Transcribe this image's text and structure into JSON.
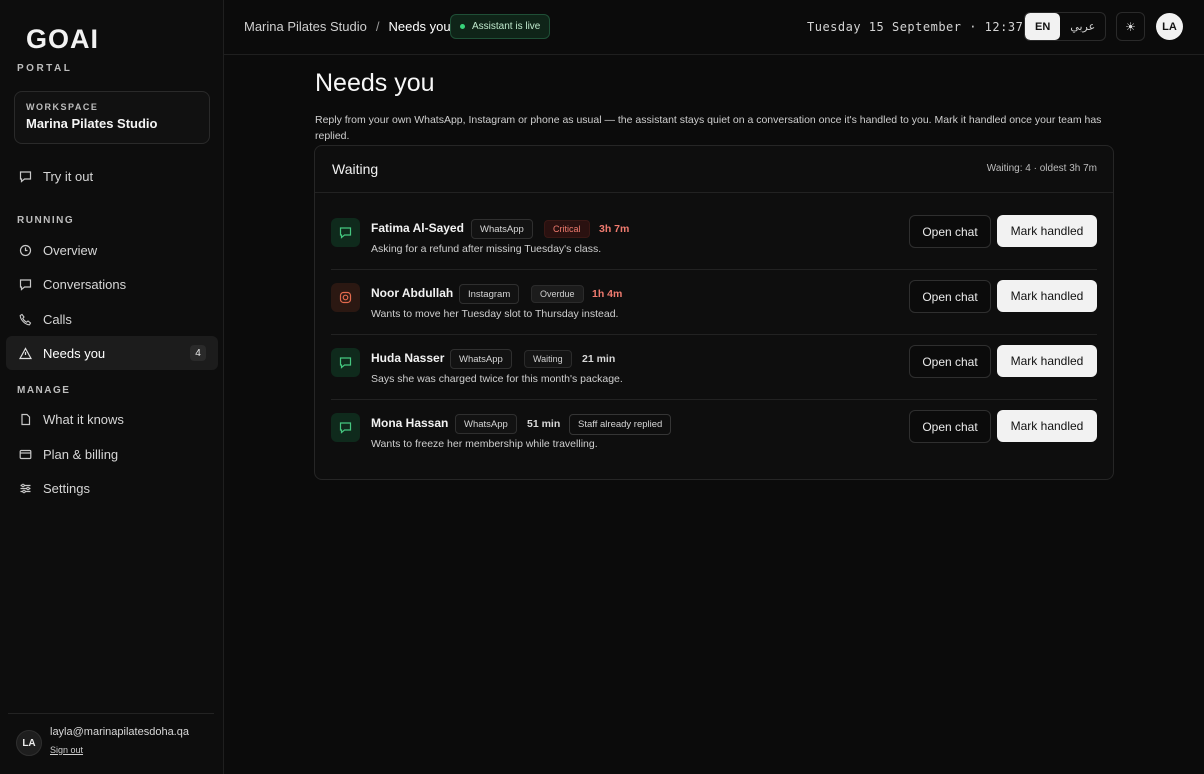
{
  "brand": {
    "logo": "GOAI",
    "sub": "PORTAL"
  },
  "workspace": {
    "label": "WORKSPACE",
    "name": "Marina Pilates Studio"
  },
  "sidebar": {
    "try_label": "Try it out",
    "running_label": "RUNNING",
    "items": [
      {
        "label": "Overview"
      },
      {
        "label": "Conversations"
      },
      {
        "label": "Calls"
      },
      {
        "label": "Needs you",
        "badge": "4"
      }
    ],
    "manage_label": "MANAGE",
    "manage_items": [
      {
        "label": "What it knows"
      },
      {
        "label": "Plan & billing"
      },
      {
        "label": "Settings"
      }
    ]
  },
  "user": {
    "initials": "LA",
    "email": "layla@marinapilatesdoha.qa",
    "sign_out": "Sign out"
  },
  "topbar": {
    "breadcrumb_root": "Marina Pilates Studio",
    "breadcrumb_sep": "/",
    "breadcrumb_current": "Needs you",
    "live_label": "Assistant is live",
    "clock": "Tuesday 15 September · 12:37 AST",
    "lang_en": "EN",
    "lang_ar": "عربي",
    "theme_icon": "☀",
    "avatar": "LA"
  },
  "page": {
    "title": "Needs you",
    "description": "Reply from your own WhatsApp, Instagram or phone as usual — the assistant stays quiet on a conversation once it's handled to you. Mark it handled once your team has replied."
  },
  "panel": {
    "title": "Waiting",
    "meta": "Waiting: 4 · oldest 3h 7m",
    "open_label": "Open chat",
    "mark_label": "Mark handled",
    "rows": [
      {
        "name": "Fatima Al-Sayed",
        "channel": "WhatsApp",
        "tag": "Critical",
        "age": "3h 7m",
        "staff": "",
        "desc": "Asking for a refund after missing Tuesday's class."
      },
      {
        "name": "Noor Abdullah",
        "channel": "Instagram",
        "tag": "Overdue",
        "age": "1h 4m",
        "staff": "",
        "desc": "Wants to move her Tuesday slot to Thursday instead."
      },
      {
        "name": "Huda Nasser",
        "channel": "WhatsApp",
        "tag": "Waiting",
        "age": "21 min",
        "staff": "",
        "desc": "Says she was charged twice for this month's package."
      },
      {
        "name": "Mona Hassan",
        "channel": "WhatsApp",
        "tag": "",
        "age": "51 min",
        "staff": "Staff already replied",
        "desc": "Wants to freeze her membership while travelling."
      }
    ]
  }
}
